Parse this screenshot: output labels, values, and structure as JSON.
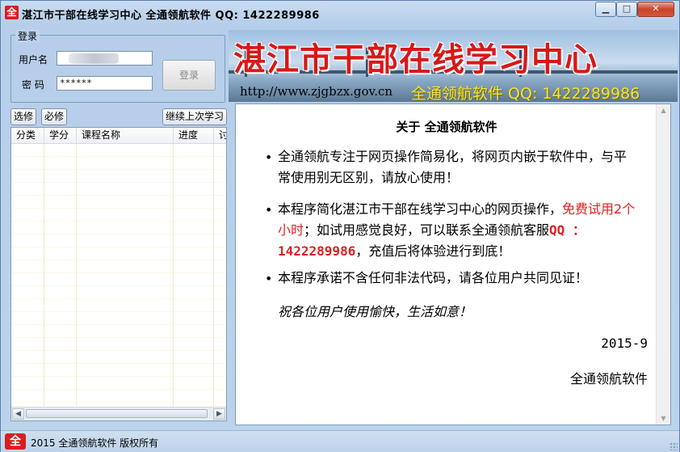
{
  "window": {
    "title": "湛江市干部在线学习中心  全通领航软件  QQ: 1422289986",
    "icon_glyph": "全",
    "controls": {
      "minimize": "▁",
      "maximize": "□",
      "close": "✕"
    }
  },
  "login": {
    "group_label": "登录",
    "username_label": "用户名",
    "password_label": "密  码",
    "password_value": "******",
    "login_button": "登录"
  },
  "toolbar": {
    "elective": "选修",
    "required": "必修",
    "continue": "继续上次学习"
  },
  "course_list": {
    "columns": [
      "分类",
      "学分",
      "课程名称",
      "进度",
      "讨"
    ],
    "rows": []
  },
  "banner": {
    "title": "湛江市干部在线学习中心",
    "url": "http://www.zjgbzx.gov.cn",
    "contact": "全通领航软件 QQ: 1422289986"
  },
  "about": {
    "title": "关于  全通领航软件",
    "p1": "全通领航专注于网页操作简易化，将网页内嵌于软件中，与平常使用别无区别，请放心使用！",
    "p2_a": "本程序简化湛江市干部在线学习中心的网页操作，",
    "p2_red": "免费试用2个小时",
    "p2_b": "；如试用感觉良好，可以联系全通领航客服",
    "p2_qq": "QQ ：1422289986",
    "p2_c": "，充值后将体验进行到底！",
    "p3": "本程序承诺不含任何非法代码，请各位用户共同见证！",
    "wish": "祝各位用户使用愉快，生活如意！",
    "date": "2015-9",
    "signature": "全通领航软件"
  },
  "status": {
    "icon_glyph": "全",
    "text": "2015  全通领航软件  版权所有"
  }
}
